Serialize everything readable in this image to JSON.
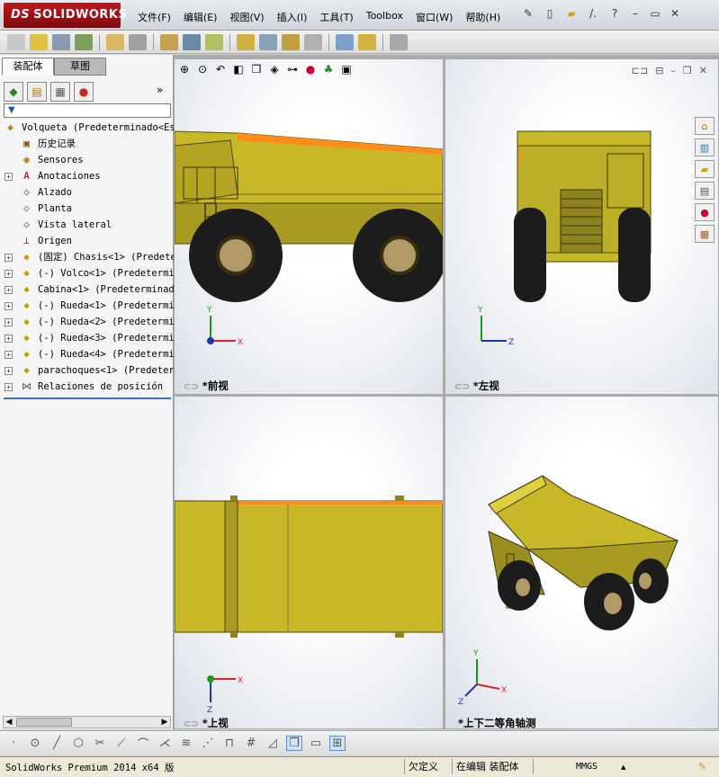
{
  "app": {
    "brand_prefix": "DS",
    "brand": "SOLIDWORKS",
    "menus": [
      "文件(F)",
      "编辑(E)",
      "视图(V)",
      "插入(I)",
      "工具(T)",
      "Toolbox",
      "窗口(W)",
      "帮助(H)"
    ]
  },
  "left_panel": {
    "tabs": [
      "装配体",
      "草图"
    ],
    "more_glyph": "»",
    "filter_glyph": "▼",
    "tree": [
      {
        "label": "Volqueta  (Predeterminado<Es",
        "icon": "assembly-icon",
        "indent": 0,
        "expander": ""
      },
      {
        "label": "历史记录",
        "icon": "history-icon",
        "indent": 1,
        "expander": ""
      },
      {
        "label": "Sensores",
        "icon": "sensor-icon",
        "indent": 1,
        "expander": ""
      },
      {
        "label": "Anotaciones",
        "icon": "annotation-icon",
        "indent": 1,
        "expander": "+"
      },
      {
        "label": "Alzado",
        "icon": "plane-icon",
        "indent": 1,
        "expander": ""
      },
      {
        "label": "Planta",
        "icon": "plane-icon",
        "indent": 1,
        "expander": ""
      },
      {
        "label": "Vista lateral",
        "icon": "plane-icon",
        "indent": 1,
        "expander": ""
      },
      {
        "label": "Origen",
        "icon": "origin-icon",
        "indent": 1,
        "expander": ""
      },
      {
        "label": "(固定) Chasis<1> (Predete",
        "icon": "component-icon",
        "indent": 1,
        "expander": "+"
      },
      {
        "label": "(-) Volco<1> (Predetermin",
        "icon": "component-icon",
        "indent": 1,
        "expander": "+"
      },
      {
        "label": "Cabina<1> (Predeterminado",
        "icon": "component-icon",
        "indent": 1,
        "expander": "+"
      },
      {
        "label": "(-) Rueda<1> (Predetermin",
        "icon": "component-icon",
        "indent": 1,
        "expander": "+"
      },
      {
        "label": "(-) Rueda<2> (Predetermin",
        "icon": "component-icon",
        "indent": 1,
        "expander": "+"
      },
      {
        "label": "(-) Rueda<3> (Predetermin",
        "icon": "component-icon",
        "indent": 1,
        "expander": "+"
      },
      {
        "label": "(-) Rueda<4> (Predetermin",
        "icon": "component-icon",
        "indent": 1,
        "expander": "+"
      },
      {
        "label": "parachoques<1> (Predeterm",
        "icon": "component-icon",
        "indent": 1,
        "expander": "+"
      },
      {
        "label": "Relaciones de posición",
        "icon": "mate-icon",
        "indent": 1,
        "expander": "+"
      }
    ]
  },
  "viewports": {
    "front": "*前视",
    "left": "*左视",
    "top": "*上视",
    "iso": "*上下二等角轴测"
  },
  "axes": {
    "x": "X",
    "y": "Y",
    "z": "Z"
  },
  "status": {
    "product": "SolidWorks Premium 2014 x64 版",
    "state": "欠定义",
    "mode": "在编辑 装配体",
    "units": "MMGS"
  },
  "colors": {
    "truck_body": "#c8b828",
    "truck_dark": "#8d8420",
    "bed_rim": "#ff8c1a",
    "tire": "#1c1c1c",
    "hub": "#b29a68",
    "accent_blue": "#3a6fc4"
  }
}
